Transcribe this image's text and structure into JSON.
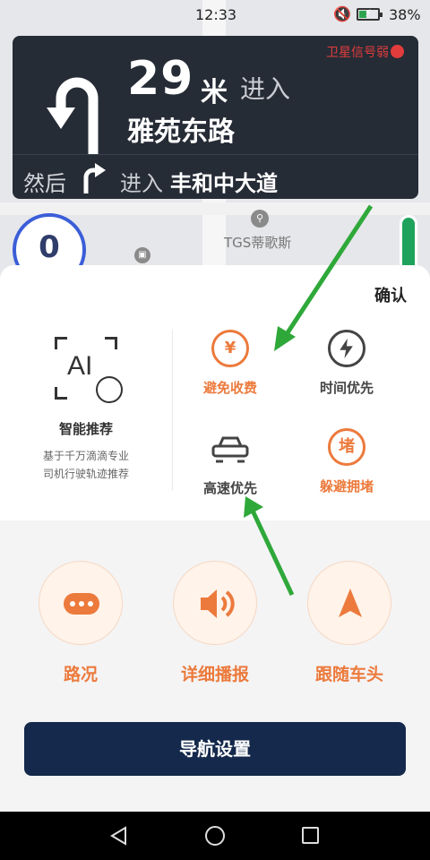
{
  "status_bar": {
    "time": "12:33",
    "battery_percent": "38%",
    "battery_level": 0.38
  },
  "guidance": {
    "distance": "29",
    "unit": "米",
    "action": "进入",
    "road": "雅苑东路",
    "gps_status": "卫星信号弱",
    "then_label": "然后",
    "then_action": "进入",
    "next_road": "丰和中大道"
  },
  "map": {
    "poi_label": "TGS蒂歌斯",
    "speed": "0"
  },
  "sheet": {
    "confirm_label": "确认",
    "ai": {
      "icon_text": "AI",
      "title": "智能推荐",
      "desc_line1": "基于千万滴滴专业",
      "desc_line2": "司机行驶轨迹推荐"
    },
    "options": [
      {
        "label": "避免收费",
        "icon": "yen-icon",
        "icon_text": "¥",
        "selected": true
      },
      {
        "label": "时间优先",
        "icon": "lightning-clock-icon",
        "icon_text": "",
        "selected": false
      },
      {
        "label": "高速优先",
        "icon": "highway-car-icon",
        "icon_text": "",
        "selected": false
      },
      {
        "label": "躲避拥堵",
        "icon": "congestion-icon",
        "icon_text": "堵",
        "selected": true
      }
    ],
    "round_buttons": [
      {
        "label": "路况",
        "icon": "traffic-icon"
      },
      {
        "label": "详细播报",
        "icon": "speaker-icon"
      },
      {
        "label": "跟随车头",
        "icon": "heading-arrow-icon"
      }
    ],
    "nav_settings_label": "导航设置"
  },
  "colors": {
    "accent": "#ec7a3c",
    "guide_bg": "#262c36",
    "button_bg": "#14294b",
    "annotation_arrow": "#2fa83a"
  }
}
